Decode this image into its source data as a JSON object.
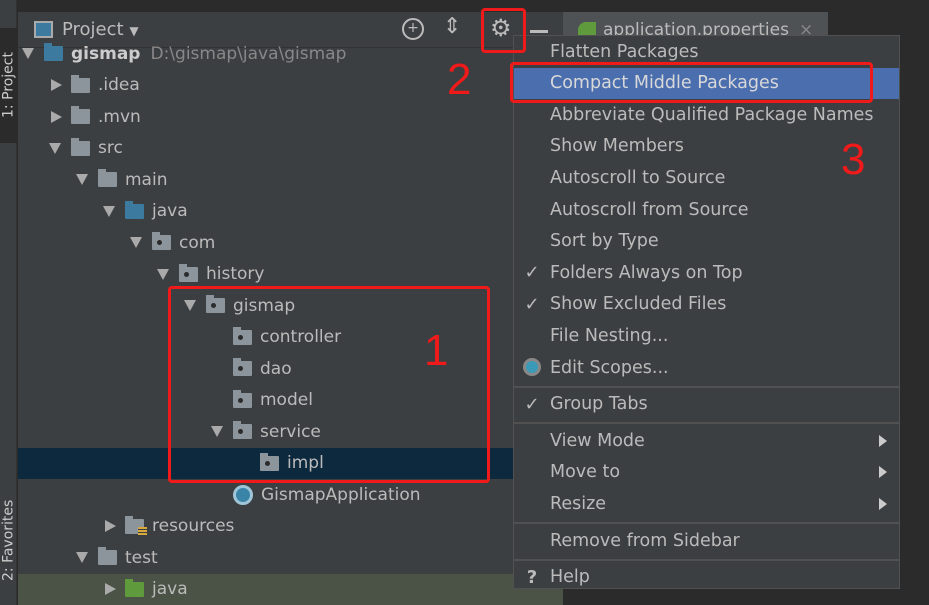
{
  "sidebar_tabs": [
    {
      "label": "1: Project"
    },
    {
      "label": "2: Favorites"
    }
  ],
  "panel": {
    "title": "Project",
    "icons": [
      "locate-icon",
      "collapse-all-icon",
      "gear-icon",
      "minimize-icon"
    ]
  },
  "editor_tab": {
    "label": "application.properties"
  },
  "tree": [
    {
      "label": "gismap",
      "path": "D:\\gismap\\java\\gismap",
      "level": 0,
      "state": "down",
      "icon": "module"
    },
    {
      "label": ".idea",
      "level": 1,
      "state": "right",
      "icon": "folder"
    },
    {
      "label": ".mvn",
      "level": 1,
      "state": "right",
      "icon": "folder"
    },
    {
      "label": "src",
      "level": 1,
      "state": "down",
      "icon": "folder"
    },
    {
      "label": "main",
      "level": 2,
      "state": "down",
      "icon": "folder"
    },
    {
      "label": "java",
      "level": 3,
      "state": "down",
      "icon": "source-folder"
    },
    {
      "label": "com",
      "level": 4,
      "state": "down",
      "icon": "package"
    },
    {
      "label": "history",
      "level": 5,
      "state": "down",
      "icon": "package"
    },
    {
      "label": "gismap",
      "level": 6,
      "state": "down",
      "icon": "package"
    },
    {
      "label": "controller",
      "level": 7,
      "state": "none",
      "icon": "package"
    },
    {
      "label": "dao",
      "level": 7,
      "state": "none",
      "icon": "package"
    },
    {
      "label": "model",
      "level": 7,
      "state": "none",
      "icon": "package"
    },
    {
      "label": "service",
      "level": 7,
      "state": "down",
      "icon": "package"
    },
    {
      "label": "impl",
      "level": 8,
      "state": "none",
      "icon": "package",
      "selected": true
    },
    {
      "label": "GismapApplication",
      "level": 7,
      "state": "none",
      "icon": "spring-class"
    },
    {
      "label": "resources",
      "level": 3,
      "state": "right",
      "icon": "resources"
    },
    {
      "label": "test",
      "level": 2,
      "state": "down",
      "icon": "folder"
    },
    {
      "label": "java",
      "level": 3,
      "state": "right",
      "icon": "test-folder",
      "highlight": true
    }
  ],
  "menu": {
    "items": [
      {
        "label": "Flatten Packages"
      },
      {
        "label": "Compact Middle Packages",
        "highlighted": true
      },
      {
        "label": "Abbreviate Qualified Package Names"
      },
      {
        "label": "Show Members"
      },
      {
        "label": "Autoscroll to Source"
      },
      {
        "label": "Autoscroll from Source"
      },
      {
        "label": "Sort by Type"
      },
      {
        "label": "Folders Always on Top",
        "checked": true
      },
      {
        "label": "Show Excluded Files",
        "checked": true
      },
      {
        "label": "File Nesting..."
      },
      {
        "label": "Edit Scopes...",
        "icon": "radio-icon"
      },
      {
        "label": "Group Tabs",
        "checked": true,
        "separator_before": true
      },
      {
        "label": "View Mode",
        "submenu": true,
        "separator_before": true
      },
      {
        "label": "Move to",
        "submenu": true
      },
      {
        "label": "Resize",
        "submenu": true
      },
      {
        "label": "Remove from Sidebar",
        "separator_before": true
      },
      {
        "label": "Help",
        "icon": "help-icon",
        "separator_before": true
      }
    ]
  },
  "annotations": [
    {
      "label": "1"
    },
    {
      "label": "2"
    },
    {
      "label": "3"
    }
  ],
  "colors": {
    "highlight": "#4b6eaf",
    "selection": "#0d293e",
    "annotation": "#f01a1a"
  }
}
